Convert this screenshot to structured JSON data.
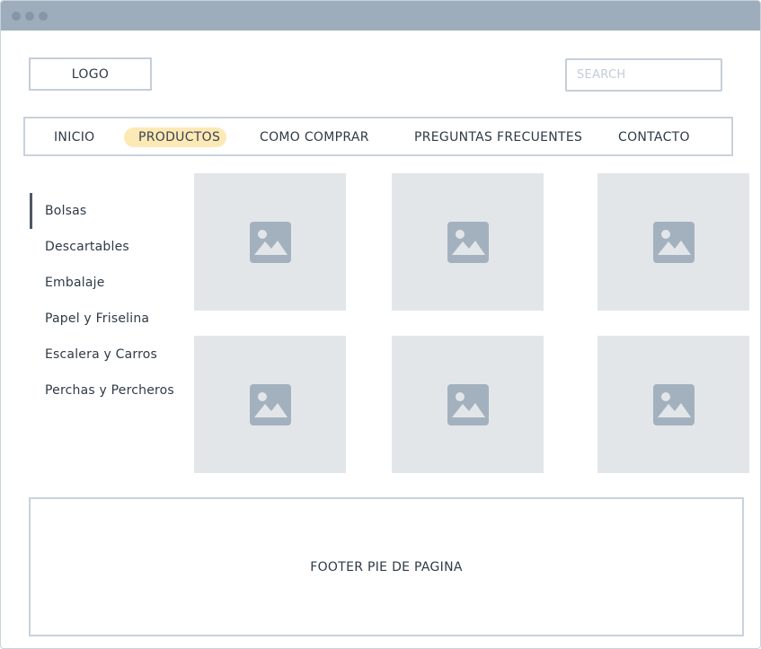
{
  "header": {
    "logo_text": "LOGO",
    "search_placeholder": "SEARCH"
  },
  "nav": {
    "items": [
      {
        "label": "INICIO",
        "active": false
      },
      {
        "label": "PRODUCTOS",
        "active": true
      },
      {
        "label": "COMO COMPRAR",
        "active": false
      },
      {
        "label": "PREGUNTAS FRECUENTES",
        "active": false
      },
      {
        "label": "CONTACTO",
        "active": false
      }
    ]
  },
  "sidebar": {
    "selected": "Bolsas",
    "items": [
      {
        "label": "Bolsas"
      },
      {
        "label": "Descartables"
      },
      {
        "label": "Embalaje"
      },
      {
        "label": "Papel y Friselina"
      },
      {
        "label": "Escalera y Carros"
      },
      {
        "label": "Perchas y Percheros"
      }
    ]
  },
  "grid": {
    "tile_icon": "image-placeholder-icon",
    "tile_count": 6
  },
  "footer": {
    "text": "FOOTER PIE DE PAGINA"
  },
  "colors": {
    "titlebar": "#9eadbb",
    "active_highlight": "#fde9b5",
    "tile_bg": "#e3e6e9",
    "icon": "#a3b1bf",
    "border": "#c9d2db"
  }
}
